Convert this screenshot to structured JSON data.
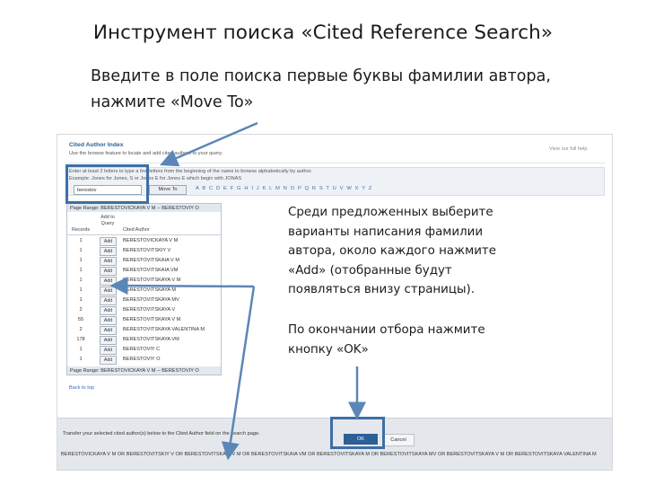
{
  "slide": {
    "title": "Инструмент поиска «Cited Reference Search»",
    "instruction": "Введите в поле поиска первые буквы фамилии автора, нажмите «Move To»",
    "callout_select": "Среди предложенных выберите варианты написания фамилии автора, около каждого нажмите «Add» (отобранные будут появляться внизу страницы).",
    "callout_ok": "По окончании отбора нажмите кнопку «OK»"
  },
  "screenshot": {
    "panel_title": "Cited Author Index",
    "hint": "Use the browse feature to locate and add cited authors to your query.",
    "help_link": "View our full help",
    "instructions_line1": "Enter at least 2 letters to type a few letters from the beginning of the name to browse alphabetically by author.",
    "instructions_line2": "Example: Jones for Jones, S or Jones E for Jones E which begin with JONAS",
    "search_value": "berestov",
    "move_to_label": "Move To",
    "alphabet": "A B C D E F G H I J K L M N O P Q R S T U V W X Y Z",
    "page_range": "Page Range: BERESTOVICKAYA V M -- BERESTOVIY O",
    "columns": {
      "records": "Records",
      "add_to_query": "Add to Query",
      "cited_author": "Cited Author"
    },
    "add_label": "Add",
    "rows": [
      {
        "records": "1",
        "author": "BERESTOVICKAYA V M"
      },
      {
        "records": "1",
        "author": "BERESTOVITSKIY V"
      },
      {
        "records": "1",
        "author": "BERESTOVITSKAIA V M"
      },
      {
        "records": "1",
        "author": "BERESTOVITSKAIA VM"
      },
      {
        "records": "1",
        "author": "BERESTOVITSKAYA V M"
      },
      {
        "records": "1",
        "author": "BERESTOVITSKAYA M"
      },
      {
        "records": "1",
        "author": "BERESTOVITSKAYA MV"
      },
      {
        "records": "2",
        "author": "BERESTOVITSKAYA V"
      },
      {
        "records": "55",
        "author": "BERESTOVITSKAYA V M"
      },
      {
        "records": "2",
        "author": "BERESTOVITSKAYA VALENTINA M"
      },
      {
        "records": "178",
        "author": "BERESTOVITSKAYA VM"
      },
      {
        "records": "1",
        "author": "BERESTOVIY C"
      },
      {
        "records": "1",
        "author": "BERESTOVIY O"
      }
    ],
    "back_link": "Back to top",
    "transfer_text": "Transfer your selected cited author(s) below to the Cited Author field on the search page.",
    "ok_label": "OK",
    "cancel_label": "Cancel",
    "selected_authors": "BERESTOVICKAYA V M OR BERESTOVITSKIY V OR BERESTOVITSKAIA V M OR BERESTOVITSKAIA VM OR BERESTOVITSKAYA M OR BERESTOVITSKAYA MV OR BERESTOVITSKAYA V M OR BERESTOVITSKAYA VALENTINA M"
  },
  "colors": {
    "highlight": "#3d6fa5",
    "ok_button": "#2b5f96",
    "link": "#3671b0"
  }
}
